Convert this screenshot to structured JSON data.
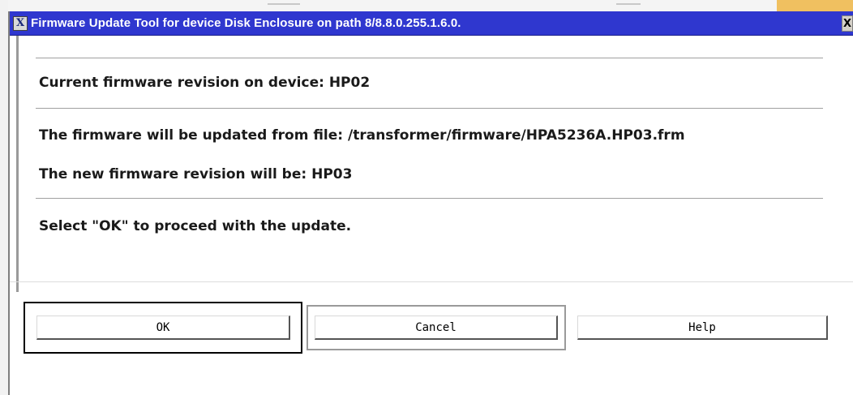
{
  "window": {
    "title": "Firmware Update Tool for device Disk Enclosure on path 8/8.8.0.255.1.6.0.",
    "title_icon": "x-window-icon",
    "close_label": "X"
  },
  "messages": {
    "current_revision": "Current firmware revision on device: HP02",
    "update_source": "The firmware will be updated from file: /transformer/firmware/HPA5236A.HP03.frm",
    "new_revision": "The new firmware revision will be: HP03",
    "instruction": "Select \"OK\" to proceed with the update."
  },
  "buttons": {
    "ok": "OK",
    "cancel": "Cancel",
    "help": "Help"
  },
  "colors": {
    "titlebar": "#2f37cf",
    "title_text": "#ffffff",
    "background": "#ffffff"
  }
}
